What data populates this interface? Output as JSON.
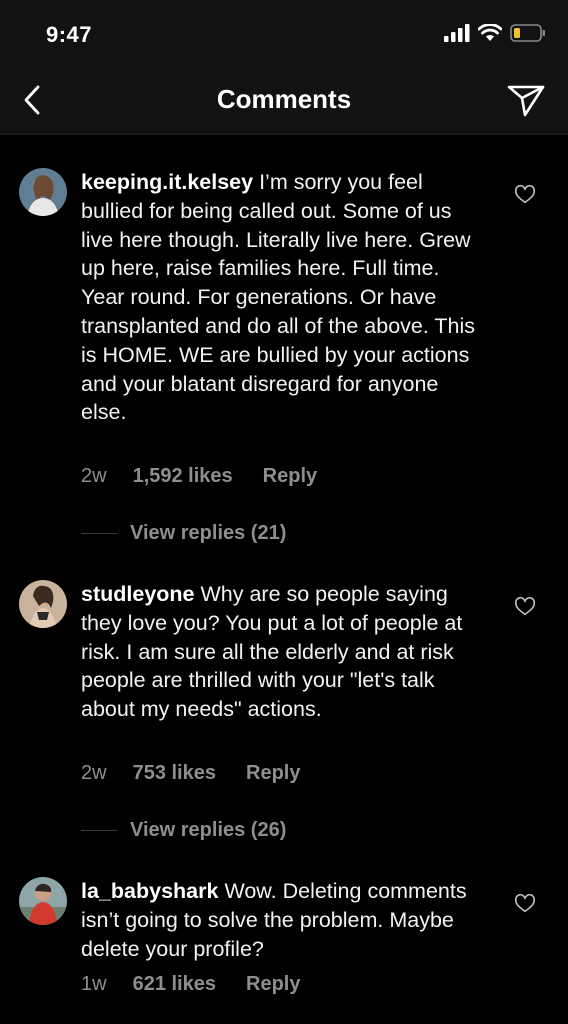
{
  "status": {
    "time": "9:47"
  },
  "nav": {
    "title": "Comments"
  },
  "comments": [
    {
      "username": "keeping.it.kelsey",
      "text": "I’m sorry you feel bullied for being called out. Some of us live here though. Literally live here. Grew up here, raise families here. Full time. Year round. For generations.  Or have transplanted and do all of the above.  This is HOME. WE are bullied by your actions and your blatant disregard for anyone else.",
      "time": "2w",
      "likes": "1,592 likes",
      "reply": "Reply",
      "view_replies": "View replies (21)"
    },
    {
      "username": "studleyone",
      "text": "Why are so people saying they love you? You put a lot of people at risk. I am sure all the elderly and at risk people are thrilled with your \"let's talk about my needs\" actions.",
      "time": "2w",
      "likes": "753 likes",
      "reply": "Reply",
      "view_replies": "View replies (26)"
    },
    {
      "username": "la_babyshark",
      "text": "Wow. Deleting comments isn’t going to solve the problem. Maybe delete your profile?",
      "time": "1w",
      "likes": "621 likes",
      "reply": "Reply"
    }
  ]
}
